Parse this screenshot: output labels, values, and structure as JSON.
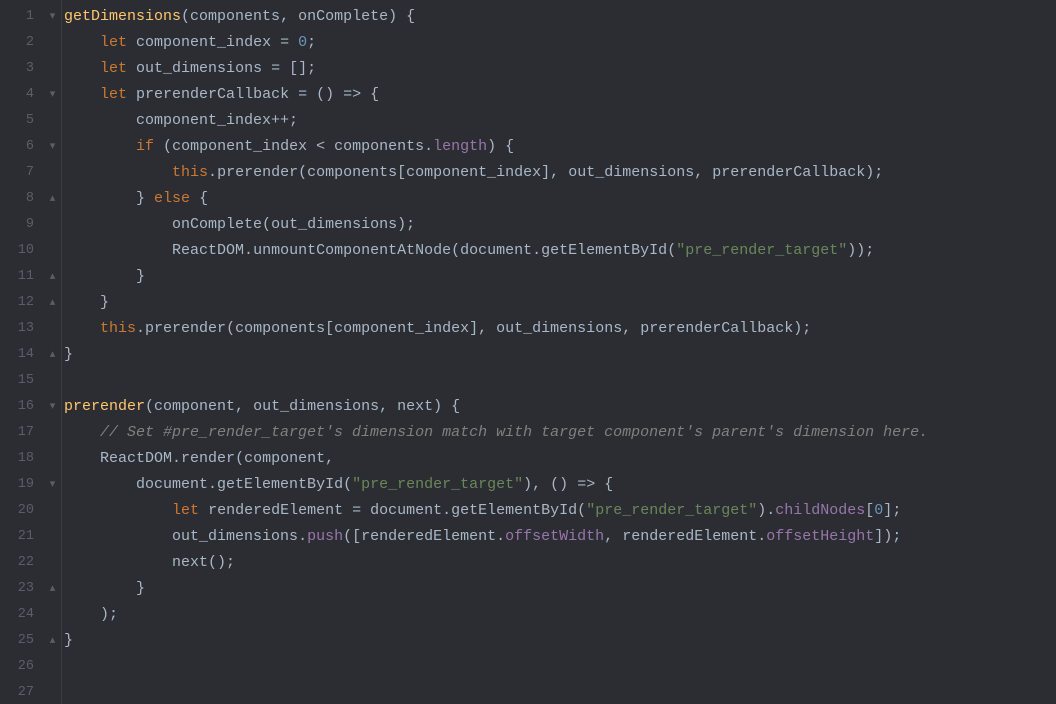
{
  "lines": {
    "l1": {
      "num": "1",
      "fold": "▾"
    },
    "l2": {
      "num": "2",
      "fold": ""
    },
    "l3": {
      "num": "3",
      "fold": ""
    },
    "l4": {
      "num": "4",
      "fold": "▾"
    },
    "l5": {
      "num": "5",
      "fold": ""
    },
    "l6": {
      "num": "6",
      "fold": "▾"
    },
    "l7": {
      "num": "7",
      "fold": ""
    },
    "l8": {
      "num": "8",
      "fold": "▴"
    },
    "l9": {
      "num": "9",
      "fold": ""
    },
    "l10": {
      "num": "10",
      "fold": ""
    },
    "l11": {
      "num": "11",
      "fold": "▴"
    },
    "l12": {
      "num": "12",
      "fold": "▴"
    },
    "l13": {
      "num": "13",
      "fold": ""
    },
    "l14": {
      "num": "14",
      "fold": "▴"
    },
    "l15": {
      "num": "15",
      "fold": ""
    },
    "l16": {
      "num": "16",
      "fold": "▾"
    },
    "l17": {
      "num": "17",
      "fold": ""
    },
    "l18": {
      "num": "18",
      "fold": ""
    },
    "l19": {
      "num": "19",
      "fold": "▾"
    },
    "l20": {
      "num": "20",
      "fold": ""
    },
    "l21": {
      "num": "21",
      "fold": ""
    },
    "l22": {
      "num": "22",
      "fold": ""
    },
    "l23": {
      "num": "23",
      "fold": "▴"
    },
    "l24": {
      "num": "24",
      "fold": ""
    },
    "l25": {
      "num": "25",
      "fold": "▴"
    },
    "l26": {
      "num": "26",
      "fold": ""
    },
    "l27": {
      "num": "27",
      "fold": ""
    }
  },
  "tok": {
    "kw_let": "let",
    "kw_if": "if",
    "kw_else": "else",
    "kw_this": "this",
    "num_0": "0",
    "str_pre_render_target": "\"pre_render_target\"",
    "fn_getDimensions": "getDimensions",
    "fn_prerender": "prerender",
    "id_components": "components",
    "id_onComplete": "onComplete",
    "id_component_index": "component_index",
    "id_out_dimensions": "out_dimensions",
    "id_prerenderCallback": "prerenderCallback",
    "id_ReactDOM": "ReactDOM",
    "id_unmountComponentAtNode": "unmountComponentAtNode",
    "id_document": "document",
    "id_getElementById": "getElementById",
    "id_component": "component",
    "id_next": "next",
    "id_render": "render",
    "id_renderedElement": "renderedElement",
    "prop_length": "length",
    "prop_childNodes": "childNodes",
    "prop_offsetWidth": "offsetWidth",
    "prop_offsetHeight": "offsetHeight",
    "prop_push": "push",
    "comment17": "// Set #pre_render_target's dimension match with target component's parent's dimension here."
  },
  "punct": {
    "open_paren": "(",
    "close_paren": ")",
    "comma_sp": ", ",
    "obrace_sp": " {",
    "obrace": "{",
    "cbrace": "}",
    "semi": ";",
    "eq_sp": " = ",
    "arrow_sp": " => ",
    "lt_sp": " < ",
    "dot": ".",
    "pp_semi": "++;",
    "empty_arr_semi": " = [];",
    "obracket": "[",
    "cbracket": "]",
    "call_end_semi": ");",
    "call_end_dbl_semi": "));",
    "empty_call_semi": "();",
    "comma": ", "
  }
}
